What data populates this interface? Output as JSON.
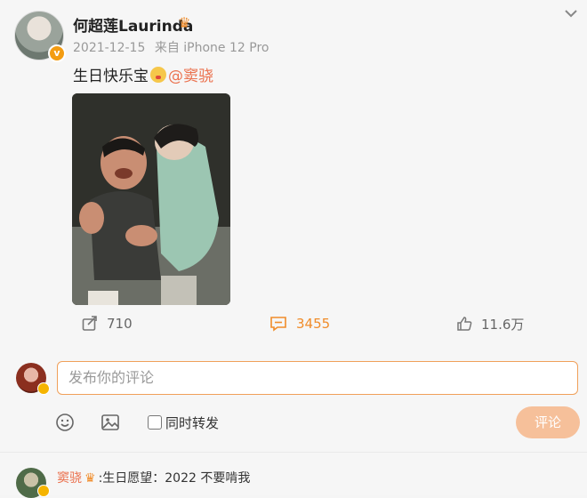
{
  "post": {
    "username": "何超莲Laurinda",
    "date": "2021-12-15",
    "source": "来自 iPhone 12 Pro",
    "text": "生日快乐宝",
    "mention": "@窦骁"
  },
  "actions": {
    "repost_count": "710",
    "comment_count": "3455",
    "like_count": "11.6万"
  },
  "comment_box": {
    "placeholder": "发布你的评论",
    "also_repost_label": "同时转发",
    "submit_label": "评论"
  },
  "reply": {
    "name": "窦骁",
    "text": ":生日愿望：2022 不要啃我"
  },
  "colors": {
    "accent": "#f08c2a",
    "mention": "#eb7350",
    "submit_bg": "#f6c09a"
  }
}
